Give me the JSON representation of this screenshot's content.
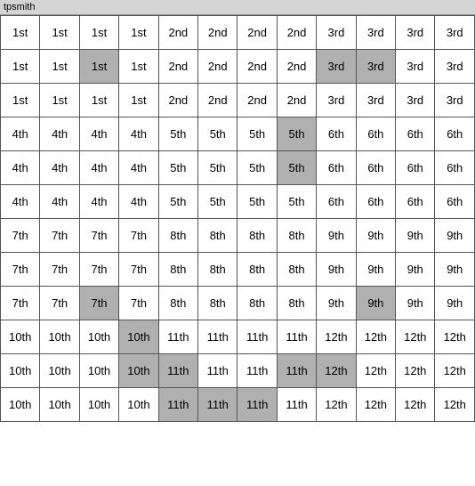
{
  "title": "tpsmith",
  "grid": {
    "rows": [
      [
        {
          "text": "1st",
          "h": false
        },
        {
          "text": "1st",
          "h": false
        },
        {
          "text": "1st",
          "h": false
        },
        {
          "text": "1st",
          "h": false
        },
        {
          "text": "2nd",
          "h": false
        },
        {
          "text": "2nd",
          "h": false
        },
        {
          "text": "2nd",
          "h": false
        },
        {
          "text": "2nd",
          "h": false
        },
        {
          "text": "3rd",
          "h": false
        },
        {
          "text": "3rd",
          "h": false
        },
        {
          "text": "3rd",
          "h": false
        },
        {
          "text": "3rd",
          "h": false
        }
      ],
      [
        {
          "text": "1st",
          "h": false
        },
        {
          "text": "1st",
          "h": false
        },
        {
          "text": "1st",
          "h": true
        },
        {
          "text": "1st",
          "h": false
        },
        {
          "text": "2nd",
          "h": false
        },
        {
          "text": "2nd",
          "h": false
        },
        {
          "text": "2nd",
          "h": false
        },
        {
          "text": "2nd",
          "h": false
        },
        {
          "text": "3rd",
          "h": true
        },
        {
          "text": "3rd",
          "h": true
        },
        {
          "text": "3rd",
          "h": false
        },
        {
          "text": "3rd",
          "h": false
        }
      ],
      [
        {
          "text": "1st",
          "h": false
        },
        {
          "text": "1st",
          "h": false
        },
        {
          "text": "1st",
          "h": false
        },
        {
          "text": "1st",
          "h": false
        },
        {
          "text": "2nd",
          "h": false
        },
        {
          "text": "2nd",
          "h": false
        },
        {
          "text": "2nd",
          "h": false
        },
        {
          "text": "2nd",
          "h": false
        },
        {
          "text": "3rd",
          "h": false
        },
        {
          "text": "3rd",
          "h": false
        },
        {
          "text": "3rd",
          "h": false
        },
        {
          "text": "3rd",
          "h": false
        }
      ],
      [
        {
          "text": "4th",
          "h": false
        },
        {
          "text": "4th",
          "h": false
        },
        {
          "text": "4th",
          "h": false
        },
        {
          "text": "4th",
          "h": false
        },
        {
          "text": "5th",
          "h": false
        },
        {
          "text": "5th",
          "h": false
        },
        {
          "text": "5th",
          "h": false
        },
        {
          "text": "5th",
          "h": true
        },
        {
          "text": "6th",
          "h": false
        },
        {
          "text": "6th",
          "h": false
        },
        {
          "text": "6th",
          "h": false
        },
        {
          "text": "6th",
          "h": false
        }
      ],
      [
        {
          "text": "4th",
          "h": false
        },
        {
          "text": "4th",
          "h": false
        },
        {
          "text": "4th",
          "h": false
        },
        {
          "text": "4th",
          "h": false
        },
        {
          "text": "5th",
          "h": false
        },
        {
          "text": "5th",
          "h": false
        },
        {
          "text": "5th",
          "h": false
        },
        {
          "text": "5th",
          "h": true
        },
        {
          "text": "6th",
          "h": false
        },
        {
          "text": "6th",
          "h": false
        },
        {
          "text": "6th",
          "h": false
        },
        {
          "text": "6th",
          "h": false
        }
      ],
      [
        {
          "text": "4th",
          "h": false
        },
        {
          "text": "4th",
          "h": false
        },
        {
          "text": "4th",
          "h": false
        },
        {
          "text": "4th",
          "h": false
        },
        {
          "text": "5th",
          "h": false
        },
        {
          "text": "5th",
          "h": false
        },
        {
          "text": "5th",
          "h": false
        },
        {
          "text": "5th",
          "h": false
        },
        {
          "text": "6th",
          "h": false
        },
        {
          "text": "6th",
          "h": false
        },
        {
          "text": "6th",
          "h": false
        },
        {
          "text": "6th",
          "h": false
        }
      ],
      [
        {
          "text": "7th",
          "h": false
        },
        {
          "text": "7th",
          "h": false
        },
        {
          "text": "7th",
          "h": false
        },
        {
          "text": "7th",
          "h": false
        },
        {
          "text": "8th",
          "h": false
        },
        {
          "text": "8th",
          "h": false
        },
        {
          "text": "8th",
          "h": false
        },
        {
          "text": "8th",
          "h": false
        },
        {
          "text": "9th",
          "h": false
        },
        {
          "text": "9th",
          "h": false
        },
        {
          "text": "9th",
          "h": false
        },
        {
          "text": "9th",
          "h": false
        }
      ],
      [
        {
          "text": "7th",
          "h": false
        },
        {
          "text": "7th",
          "h": false
        },
        {
          "text": "7th",
          "h": false
        },
        {
          "text": "7th",
          "h": false
        },
        {
          "text": "8th",
          "h": false
        },
        {
          "text": "8th",
          "h": false
        },
        {
          "text": "8th",
          "h": false
        },
        {
          "text": "8th",
          "h": false
        },
        {
          "text": "9th",
          "h": false
        },
        {
          "text": "9th",
          "h": false
        },
        {
          "text": "9th",
          "h": false
        },
        {
          "text": "9th",
          "h": false
        }
      ],
      [
        {
          "text": "7th",
          "h": false
        },
        {
          "text": "7th",
          "h": false
        },
        {
          "text": "7th",
          "h": true
        },
        {
          "text": "7th",
          "h": false
        },
        {
          "text": "8th",
          "h": false
        },
        {
          "text": "8th",
          "h": false
        },
        {
          "text": "8th",
          "h": false
        },
        {
          "text": "8th",
          "h": false
        },
        {
          "text": "9th",
          "h": false
        },
        {
          "text": "9th",
          "h": true
        },
        {
          "text": "9th",
          "h": false
        },
        {
          "text": "9th",
          "h": false
        }
      ],
      [
        {
          "text": "10th",
          "h": false
        },
        {
          "text": "10th",
          "h": false
        },
        {
          "text": "10th",
          "h": false
        },
        {
          "text": "10th",
          "h": true
        },
        {
          "text": "11th",
          "h": false
        },
        {
          "text": "11th",
          "h": false
        },
        {
          "text": "11th",
          "h": false
        },
        {
          "text": "11th",
          "h": false
        },
        {
          "text": "12th",
          "h": false
        },
        {
          "text": "12th",
          "h": false
        },
        {
          "text": "12th",
          "h": false
        },
        {
          "text": "12th",
          "h": false
        }
      ],
      [
        {
          "text": "10th",
          "h": false
        },
        {
          "text": "10th",
          "h": false
        },
        {
          "text": "10th",
          "h": false
        },
        {
          "text": "10th",
          "h": true
        },
        {
          "text": "11th",
          "h": true
        },
        {
          "text": "11th",
          "h": false
        },
        {
          "text": "11th",
          "h": false
        },
        {
          "text": "11th",
          "h": true
        },
        {
          "text": "12th",
          "h": true
        },
        {
          "text": "12th",
          "h": false
        },
        {
          "text": "12th",
          "h": false
        },
        {
          "text": "12th",
          "h": false
        }
      ],
      [
        {
          "text": "10th",
          "h": false
        },
        {
          "text": "10th",
          "h": false
        },
        {
          "text": "10th",
          "h": false
        },
        {
          "text": "10th",
          "h": false
        },
        {
          "text": "11th",
          "h": true
        },
        {
          "text": "11th",
          "h": true
        },
        {
          "text": "11th",
          "h": true
        },
        {
          "text": "11th",
          "h": false
        },
        {
          "text": "12th",
          "h": false
        },
        {
          "text": "12th",
          "h": false
        },
        {
          "text": "12th",
          "h": false
        },
        {
          "text": "12th",
          "h": false
        }
      ]
    ]
  }
}
